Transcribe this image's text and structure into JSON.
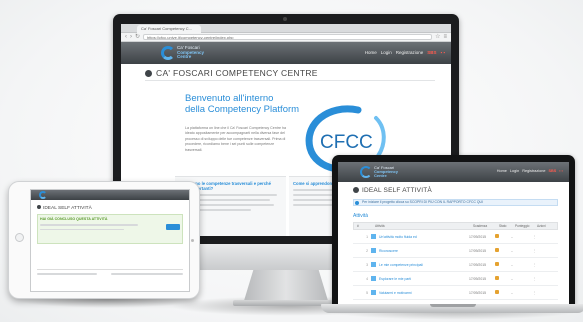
{
  "browser": {
    "tab_title": "Ca' Foscari Competency C...",
    "url": "https://cfcc.unive.it/competency-centre/index.php"
  },
  "site": {
    "logo_name": "Ca' Foscari",
    "logo_sub1": "Competency",
    "logo_sub2": "Centre",
    "menu": [
      "Home",
      "Login",
      "Registrazione",
      "SBS"
    ],
    "menu_flags": "▪ ▪"
  },
  "imac": {
    "page_title": "CA' FOSCARI COMPETENCY CENTRE",
    "welcome_heading": "Benvenuto all'interno\ndella Competency Platform",
    "welcome_body": "La piattaforma on line che il Ca' Foscari Competency Centre ha ideato appositamente per accompagnarti nella diversa fase del processo di sviluppo delle tue competenze trasversali. Prima di procedere, ricordiamo bene i sei punti sulle competenze trasversali.",
    "logo_text": "CFCC",
    "box1_title": "Cosa sono le competenze trasversali e perché sono importanti?",
    "box2_title": "Come si apprendono le competenze?"
  },
  "ipad": {
    "page_title": "IDEAL SELF ATTIVITÀ",
    "panel_text": "HAI GIÀ CONCLUSO QUESTA ATTIVITÀ"
  },
  "macbook": {
    "page_title": "IDEAL SELF ATTIVITÀ",
    "alert_text": "Per iniziare il progetto clicca su SCOPRI DI PIÙ CON IL RAPPORTO CFCC QUI",
    "activities_heading": "Attività",
    "table_headers": [
      "#",
      "Attività",
      "Scadenza",
      "Stato",
      "Punteggio",
      "Azioni"
    ],
    "rows": [
      {
        "num": "1",
        "name": "Un'attività molto fluida ed",
        "date": "17/09/2015"
      },
      {
        "num": "2",
        "name": "Riconoscere",
        "date": "17/09/2015"
      },
      {
        "num": "3",
        "name": "Le mie competenze principali",
        "date": "17/09/2015"
      },
      {
        "num": "4",
        "name": "Esplorare le mie parti",
        "date": "17/09/2015"
      },
      {
        "num": "5",
        "name": "Valutarmi e motivarmi",
        "date": "17/09/2015"
      }
    ]
  }
}
